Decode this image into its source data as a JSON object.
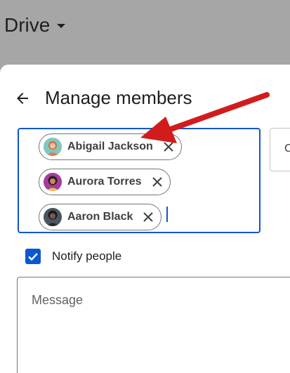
{
  "app": {
    "title": "Drive"
  },
  "dialog": {
    "title": "Manage members",
    "chips": [
      {
        "name": "Abigail Jackson",
        "avatar": "avatar-abigail"
      },
      {
        "name": "Aurora Torres",
        "avatar": "avatar-aurora"
      },
      {
        "name": "Aaron Black",
        "avatar": "avatar-aaron"
      }
    ],
    "side_letter": "C",
    "notify_label": "Notify people",
    "notify_checked": true,
    "message_placeholder": "Message"
  },
  "icons": {
    "back": "arrow-left-icon",
    "remove": "close-icon",
    "check": "check-icon",
    "dropdown": "caret-down-icon"
  },
  "colors": {
    "accent": "#0b57d0",
    "annotation_arrow": "#d21c1c",
    "header_bg": "#a6a6a6"
  }
}
